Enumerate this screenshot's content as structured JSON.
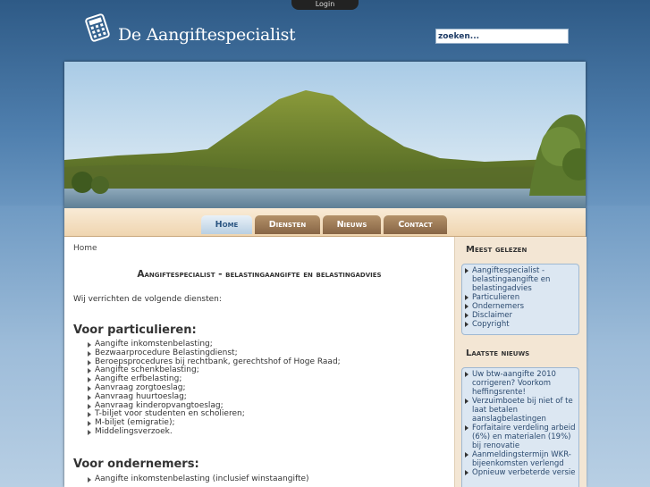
{
  "header": {
    "login_label": "Login",
    "site_title": "De Aangiftespecialist",
    "search_value": "zoeken..."
  },
  "nav": {
    "tabs": [
      "Home",
      "Diensten",
      "Nieuws",
      "Contact"
    ],
    "active": "Home"
  },
  "content": {
    "breadcrumb": "Home",
    "title": "Aangiftespecialist - belastingaangifte en belastingadvies",
    "intro": "Wij verrichten de volgende diensten:",
    "sections": [
      {
        "heading": "Voor particulieren:",
        "items": [
          "Aangifte inkomstenbelasting;",
          "Bezwaarprocedure Belastingdienst;",
          "Beroepsprocedures bij rechtbank, gerechtshof of Hoge Raad;",
          "Aangifte schenkbelasting;",
          "Aangifte erfbelasting;",
          "Aanvraag zorgtoeslag;",
          "Aanvraag huurtoeslag;",
          "Aanvraag kinderopvangtoeslag;",
          "T-biljet voor studenten en scholieren;",
          "M-biljet (emigratie);",
          "Middelingsverzoek."
        ]
      },
      {
        "heading": "Voor ondernemers:",
        "items": [
          "Aangifte inkomstenbelasting (inclusief winstaangifte)"
        ]
      }
    ]
  },
  "sidebar": {
    "most_read": {
      "heading": "Meest gelezen",
      "items": [
        "Aangiftespecialist - belastingaangifte en belastingadvies",
        "Particulieren",
        "Ondernemers",
        "Disclaimer",
        "Copyright"
      ]
    },
    "latest_news": {
      "heading": "Laatste nieuws",
      "items": [
        "Uw btw-aangifte 2010 corrigeren? Voorkom heffingsrente!",
        "Verzuimboete bij niet of te laat betalen aanslagbelastingen",
        "Forfaitaire verdeling arbeid (6%) en materialen (19%) bij renovatie",
        "Aanmeldingstermijn WKR-bijeenkomsten verlengd",
        "Opnieuw verbeterde versie"
      ]
    }
  },
  "colors": {
    "background": "#3f6d99",
    "nav_tab": "#9b7a56",
    "nav_tab_active": "#cfdeec",
    "sidebar_bg": "#f3e6d4",
    "sidebar_box": "#dce7f2"
  },
  "icons": {
    "logo": "calculator-icon",
    "bullet": "triangle-right-icon"
  }
}
